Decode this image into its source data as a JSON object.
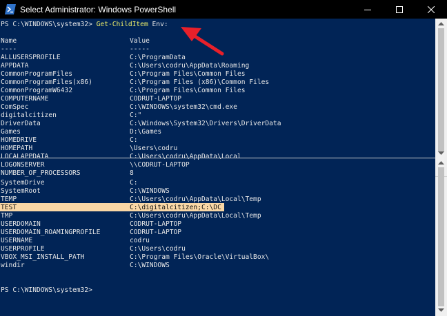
{
  "window": {
    "title": "Select Administrator: Windows PowerShell"
  },
  "top_pane": {
    "prompt": "PS C:\\WINDOWS\\system32>",
    "command": "Get-ChildItem",
    "argument": "Env:",
    "header": {
      "name": "Name",
      "value": "Value"
    },
    "underline": {
      "name": "----",
      "value": "-----"
    },
    "rows": [
      {
        "name": "ALLUSERSPROFILE",
        "value": "C:\\ProgramData"
      },
      {
        "name": "APPDATA",
        "value": "C:\\Users\\codru\\AppData\\Roaming"
      },
      {
        "name": "CommonProgramFiles",
        "value": "C:\\Program Files\\Common Files"
      },
      {
        "name": "CommonProgramFiles(x86)",
        "value": "C:\\Program Files (x86)\\Common Files"
      },
      {
        "name": "CommonProgramW6432",
        "value": "C:\\Program Files\\Common Files"
      },
      {
        "name": "COMPUTERNAME",
        "value": "CODRUT-LAPTOP"
      },
      {
        "name": "ComSpec",
        "value": "C:\\WINDOWS\\system32\\cmd.exe"
      },
      {
        "name": "digitalcitizen",
        "value": "C:\""
      },
      {
        "name": "DriverData",
        "value": "C:\\Windows\\System32\\Drivers\\DriverData"
      },
      {
        "name": "Games",
        "value": "D:\\Games"
      },
      {
        "name": "HOMEDRIVE",
        "value": "C:"
      },
      {
        "name": "HOMEPATH",
        "value": "\\Users\\codru"
      },
      {
        "name": "LOCALAPPDATA",
        "value": "C:\\Users\\codru\\AppData\\Local"
      },
      {
        "name": "LOGONSERVER",
        "value": "\\\\CODRUT-LAPTOP"
      },
      {
        "name": "NUMBER_OF_PROCESSORS",
        "value": "8"
      }
    ]
  },
  "bottom_pane": {
    "rows": [
      {
        "name": "SystemDrive",
        "value": "C:"
      },
      {
        "name": "SystemRoot",
        "value": "C:\\WINDOWS"
      },
      {
        "name": "TEMP",
        "value": "C:\\Users\\codru\\AppData\\Local\\Temp"
      },
      {
        "name": "TEST",
        "value": "C:\\digitalcitizen;C:\\DC",
        "selected": true
      },
      {
        "name": "TMP",
        "value": "C:\\Users\\codru\\AppData\\Local\\Temp"
      },
      {
        "name": "USERDOMAIN",
        "value": "CODRUT-LAPTOP"
      },
      {
        "name": "USERDOMAIN_ROAMINGPROFILE",
        "value": "CODRUT-LAPTOP"
      },
      {
        "name": "USERNAME",
        "value": "codru"
      },
      {
        "name": "USERPROFILE",
        "value": "C:\\Users\\codru"
      },
      {
        "name": "VBOX_MSI_INSTALL_PATH",
        "value": "C:\\Program Files\\Oracle\\VirtualBox\\"
      },
      {
        "name": "windir",
        "value": "C:\\WINDOWS"
      }
    ],
    "prompt": "PS C:\\WINDOWS\\system32>"
  },
  "colors": {
    "console_background": "#012456",
    "console_text": "#e8e8e8",
    "command_text": "#f3f36a",
    "selection_highlight": "#f9d7a6",
    "annotation_arrow": "#e8202a"
  },
  "icons": {
    "app": "powershell-icon",
    "minimize": "minimize-icon",
    "maximize": "maximize-icon",
    "close": "close-icon",
    "annotation": "red-arrow-icon"
  }
}
